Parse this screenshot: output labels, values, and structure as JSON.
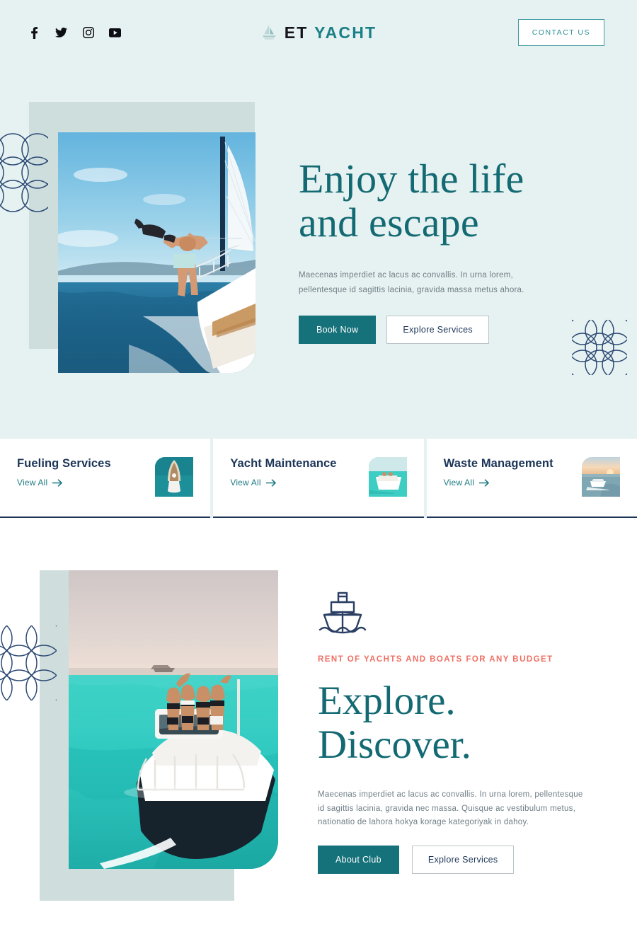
{
  "header": {
    "social": [
      {
        "name": "facebook-icon",
        "label": "Facebook"
      },
      {
        "name": "twitter-icon",
        "label": "Twitter"
      },
      {
        "name": "instagram-icon",
        "label": "Instagram"
      },
      {
        "name": "youtube-icon",
        "label": "YouTube"
      }
    ],
    "logo": {
      "mark": "sailboat-icon",
      "text_primary": "ET",
      "text_accent": "YACHT"
    },
    "contact_label": "CONTACT US"
  },
  "hero": {
    "title_line1": "Enjoy the life",
    "title_line2": "and escape",
    "paragraph": "Maecenas imperdiet ac lacus ac convallis. In urna lorem, pellentesque id sagittis lacinia, gravida massa metus ahora.",
    "primary_button": "Book Now",
    "secondary_button": "Explore Services",
    "image_alt": "Man leaning off the side of a sailing yacht at sea"
  },
  "services": [
    {
      "title": "Fueling Services",
      "link_label": "View All",
      "thumb": "yacht-bow-aerial-thumb"
    },
    {
      "title": "Yacht Maintenance",
      "link_label": "View All",
      "thumb": "yacht-deck-thumb"
    },
    {
      "title": "Waste Management",
      "link_label": "View All",
      "thumb": "boat-sunset-thumb"
    }
  ],
  "section2": {
    "icon": "ship-front-icon",
    "eyebrow": "RENT OF YACHTS AND BOATS FOR ANY BUDGET",
    "title_line1": "Explore.",
    "title_line2": "Discover.",
    "paragraph": "Maecenas imperdiet ac lacus ac convallis. In urna lorem, pellentesque id sagittis lacinia, gravida nec massa. Quisque ac vestibulum metus, nationatio de lahora hokya korage kategoriyak in dahoy.",
    "primary_button": "About Club",
    "secondary_button": "Explore Services",
    "image_alt": "Four women standing on the bow of a white yacht in turquoise water"
  },
  "colors": {
    "hero_background": "#e6f2f1",
    "teal": "#136a73",
    "teal_button": "#15717a",
    "navy": "#1c3557",
    "coral": "#ef6f63",
    "sage_block": "#cddedd",
    "body_text": "#6f7e86"
  }
}
